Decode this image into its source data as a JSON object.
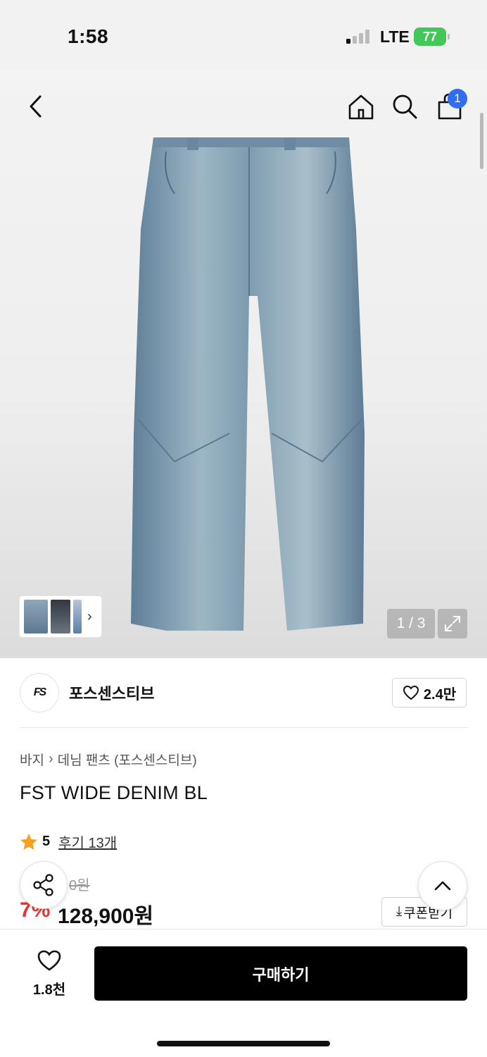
{
  "status": {
    "time": "1:58",
    "network": "LTE",
    "battery": "77"
  },
  "nav": {
    "cart_count": "1"
  },
  "gallery": {
    "counter": "1 / 3"
  },
  "brand": {
    "logo_text": "FS",
    "name": "포스센스티브",
    "likes": "2.4만"
  },
  "breadcrumb": {
    "category": "바지",
    "subcategory": "데님 팬츠 (포스센스티브)"
  },
  "product": {
    "title": "FST WIDE DENIM BL",
    "rating": "5",
    "reviews": "후기 13개",
    "original_price": "0원",
    "discount": "7%",
    "price": "128,900원",
    "coupon_label": "쿠폰받기"
  },
  "bottom_bar": {
    "wish_count": "1.8천",
    "buy_label": "구매하기"
  }
}
